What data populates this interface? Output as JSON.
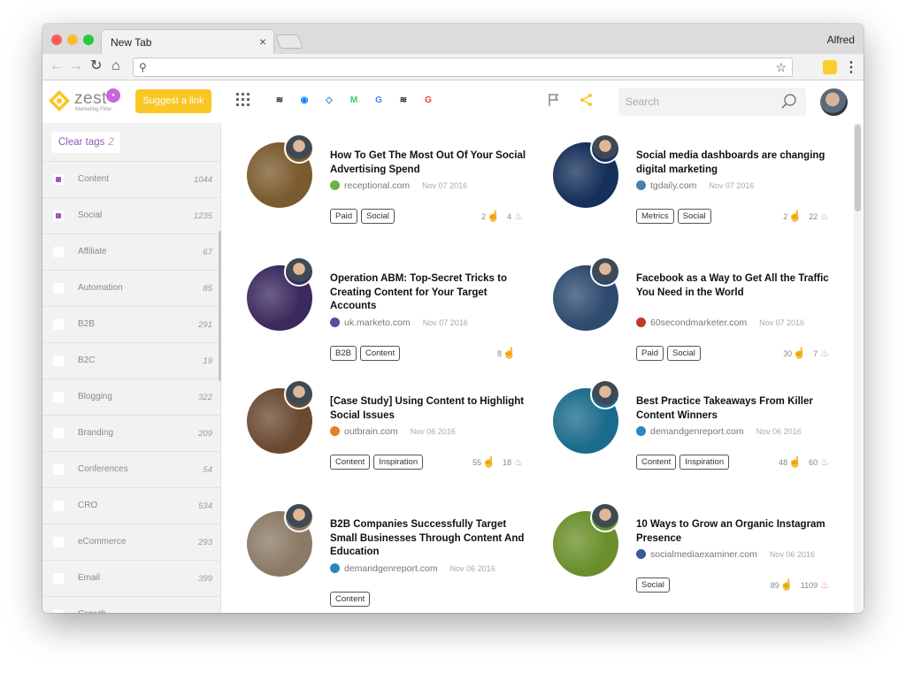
{
  "browser": {
    "tab_title": "New Tab",
    "profile_name": "Alfred",
    "address_value": ""
  },
  "app": {
    "logo_text": "zest",
    "logo_subtitle": "Marketing Flow",
    "suggest_label": "Suggest a link",
    "clear_tags_label": "Clear tags",
    "clear_tags_count": "2",
    "search_placeholder": "Search"
  },
  "tags": [
    {
      "name": "Content",
      "count": "1044",
      "checked": true
    },
    {
      "name": "Social",
      "count": "1235",
      "checked": true
    },
    {
      "name": "Affiliate",
      "count": "67",
      "checked": false
    },
    {
      "name": "Automation",
      "count": "85",
      "checked": false
    },
    {
      "name": "B2B",
      "count": "291",
      "checked": false
    },
    {
      "name": "B2C",
      "count": "19",
      "checked": false
    },
    {
      "name": "Blogging",
      "count": "322",
      "checked": false
    },
    {
      "name": "Branding",
      "count": "209",
      "checked": false
    },
    {
      "name": "Conferences",
      "count": "54",
      "checked": false
    },
    {
      "name": "CRO",
      "count": "534",
      "checked": false
    },
    {
      "name": "eCommerce",
      "count": "293",
      "checked": false
    },
    {
      "name": "Email",
      "count": "399",
      "checked": false
    },
    {
      "name": "Growth",
      "count": "",
      "checked": false
    }
  ],
  "articles": [
    {
      "title": "How To Get The Most Out Of Your Social Advertising Spend",
      "source": "receptional.com",
      "date": "Nov 07 2016",
      "tags": [
        "Paid",
        "Social"
      ],
      "clicks": "2",
      "hot": "4",
      "img_color": "#7a5a2e",
      "src_color": "#6db33f"
    },
    {
      "title": "Social media dashboards are changing digital marketing",
      "source": "tgdaily.com",
      "date": "Nov 07 2016",
      "tags": [
        "Metrics",
        "Social"
      ],
      "clicks": "2",
      "hot": "22",
      "img_color": "#16305a",
      "src_color": "#4a7fb0"
    },
    {
      "title": "Operation ABM: Top-Secret Tricks to Creating Content for Your Target Accounts",
      "source": "uk.marketo.com",
      "date": "Nov 07 2016",
      "tags": [
        "B2B",
        "Content"
      ],
      "clicks": "8",
      "hot": "",
      "img_color": "#3b2a5e",
      "src_color": "#5c4c9f"
    },
    {
      "title": "Facebook as a Way to Get All the Traffic You Need in the World",
      "source": "60secondmarketer.com",
      "date": "Nov 07 2016",
      "tags": [
        "Paid",
        "Social"
      ],
      "clicks": "30",
      "hot": "7",
      "img_color": "#2e4a6e",
      "src_color": "#c0392b"
    },
    {
      "title": "[Case Study] Using Content to Highlight Social Issues",
      "source": "outbrain.com",
      "date": "Nov 06 2016",
      "tags": [
        "Content",
        "Inspiration"
      ],
      "clicks": "55",
      "hot": "18",
      "img_color": "#6b4a32",
      "src_color": "#f07c1e"
    },
    {
      "title": "Best Practice Takeaways From Killer Content Winners",
      "source": "demandgenreport.com",
      "date": "Nov 06 2016",
      "tags": [
        "Content",
        "Inspiration"
      ],
      "clicks": "48",
      "hot": "60",
      "img_color": "#1b6b8c",
      "src_color": "#2e86c1"
    },
    {
      "title": "B2B Companies Successfully Target Small Businesses Through Content And Education",
      "source": "demandgenreport.com",
      "date": "Nov 06 2016",
      "tags": [
        "Content"
      ],
      "clicks": "",
      "hot": "",
      "img_color": "#8b7a66",
      "src_color": "#2e86c1"
    },
    {
      "title": "10 Ways to Grow an Organic Instagram Presence",
      "source": "socialmediaexaminer.com",
      "date": "Nov 06 2016",
      "tags": [
        "Social"
      ],
      "clicks": "89",
      "hot": "1109",
      "img_color": "#6a8f2a",
      "src_color": "#3b5998"
    }
  ],
  "colors": {
    "accent": "#f9c623",
    "tag_check": "#9b59b6"
  }
}
